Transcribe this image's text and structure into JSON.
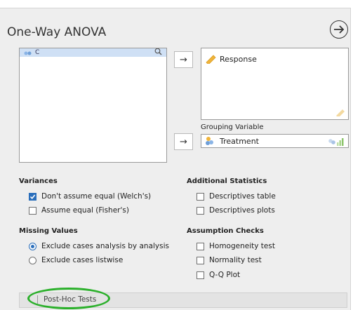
{
  "header": {
    "title": "One-Way ANOVA"
  },
  "variables": {
    "partial_item": "C"
  },
  "assign": {
    "arrow": "→"
  },
  "dependent": {
    "item": "Response"
  },
  "grouping": {
    "label": "Grouping Variable",
    "item": "Treatment"
  },
  "variances": {
    "heading": "Variances",
    "options": [
      {
        "label": "Don't assume equal (Welch's)",
        "checked": true
      },
      {
        "label": "Assume equal (Fisher's)",
        "checked": false
      }
    ]
  },
  "missing": {
    "heading": "Missing Values",
    "options": [
      {
        "label": "Exclude cases analysis by analysis",
        "selected": true
      },
      {
        "label": "Exclude cases listwise",
        "selected": false
      }
    ]
  },
  "additional": {
    "heading": "Additional Statistics",
    "options": [
      {
        "label": "Descriptives table",
        "checked": false
      },
      {
        "label": "Descriptives plots",
        "checked": false
      }
    ]
  },
  "assumptions": {
    "heading": "Assumption Checks",
    "options": [
      {
        "label": "Homogeneity test",
        "checked": false
      },
      {
        "label": "Normality test",
        "checked": false
      },
      {
        "label": "Q-Q Plot",
        "checked": false
      }
    ]
  },
  "posthoc": {
    "label": "Post-Hoc Tests"
  },
  "colors": {
    "accent": "#2a6ebb",
    "highlight_oval": "#2bb02b"
  }
}
